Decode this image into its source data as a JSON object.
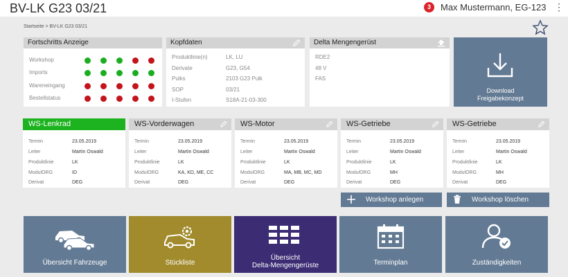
{
  "header": {
    "title": "BV-LK G23 03/21",
    "notification_count": "3",
    "user": "Max Mustermann, EG-123",
    "menu_icon": "⋮"
  },
  "breadcrumb": "Startseite  >  BV-LK G23 03/21",
  "progress": {
    "title": "Fortschritts Anzeige",
    "rows": [
      {
        "label": "Workshop",
        "status": [
          "green",
          "green",
          "green",
          "red",
          "red"
        ]
      },
      {
        "label": "Imports",
        "status": [
          "green",
          "green",
          "green",
          "green",
          "green"
        ]
      },
      {
        "label": "Wareneingang",
        "status": [
          "red",
          "red",
          "red",
          "red",
          "red"
        ]
      },
      {
        "label": "Bestellstatus",
        "status": [
          "red",
          "red",
          "red",
          "red",
          "red"
        ]
      }
    ]
  },
  "kopfdaten": {
    "title": "Kopfdaten",
    "rows": [
      {
        "key": "Produktlinie(n)",
        "value": "LK, LU"
      },
      {
        "key": "Derivate",
        "value": "G23, G54"
      },
      {
        "key": "Pulks",
        "value": "2103 G23 Pulk"
      },
      {
        "key": "SOP",
        "value": "03/21"
      },
      {
        "key": "I-Stufen",
        "value": "S18A-21-03-300"
      }
    ]
  },
  "delta": {
    "title": "Delta Mengengerüst",
    "lines": [
      "RDE2",
      "48 V",
      "FAS"
    ]
  },
  "download": {
    "label_line1": "Download",
    "label_line2": "Freigabekonzept"
  },
  "ws_labels": {
    "termin": "Termin",
    "leiter": "Leiter",
    "produktlinie": "Produktlinie",
    "modulorg": "ModulORG",
    "derivat": "Derivat"
  },
  "workshops": [
    {
      "title": "WS-Lenkrad",
      "termin": "23.05.2019",
      "leiter": "Martin Oswald",
      "produktlinie": "LK",
      "modulorg": "ID",
      "derivat": "DEG"
    },
    {
      "title": "WS-Vorderwagen",
      "termin": "23.05.2019",
      "leiter": "Martin Oswald",
      "produktlinie": "LK",
      "modulorg": "KA, KD, ME, CC",
      "derivat": "DEG"
    },
    {
      "title": "WS-Motor",
      "termin": "23.05.2019",
      "leiter": "Martin Oswald",
      "produktlinie": "LK",
      "modulorg": "MA, MB, MC, MD",
      "derivat": "DEG"
    },
    {
      "title": "WS-Getriebe",
      "termin": "23.05.2019",
      "leiter": "Martin Oswald",
      "produktlinie": "LK",
      "modulorg": "MH",
      "derivat": "DEG"
    },
    {
      "title": "WS-Getriebe",
      "termin": "23.05.2019",
      "leiter": "Martin Oswald",
      "produktlinie": "LK",
      "modulorg": "MH",
      "derivat": "DEG"
    }
  ],
  "actions": {
    "add": "Workshop anlegen",
    "delete": "Workshop löschen"
  },
  "tiles": [
    {
      "label1": "Übersicht Fahrzeuge",
      "label2": ""
    },
    {
      "label1": "Stückliste",
      "label2": ""
    },
    {
      "label1": "Übersicht",
      "label2": "Delta-Mengengerüste"
    },
    {
      "label1": "Terminplan",
      "label2": ""
    },
    {
      "label1": "Zuständigkeiten",
      "label2": ""
    }
  ],
  "colors": {
    "active_green": "#1db21f",
    "status_green": "#1aae1f",
    "status_red": "#c3141b",
    "tile_slate": "#637a94",
    "tile_olive": "#a18b2c",
    "tile_purple": "#3b2c74",
    "notification_red": "#d9232a"
  }
}
